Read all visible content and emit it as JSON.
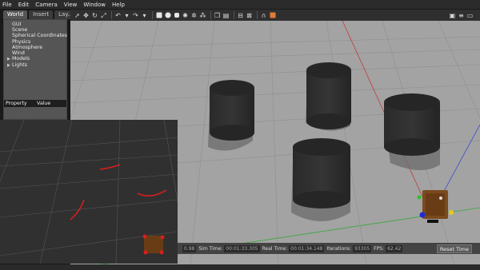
{
  "menu": [
    "File",
    "Edit",
    "Camera",
    "View",
    "Window",
    "Help"
  ],
  "left_tabs": [
    "World",
    "Insert",
    "Lay..."
  ],
  "tree": [
    {
      "label": "GUI",
      "expandable": false
    },
    {
      "label": "Scene",
      "expandable": false
    },
    {
      "label": "Spherical Coordinates",
      "expandable": false
    },
    {
      "label": "Physics",
      "expandable": false
    },
    {
      "label": "Atmosphere",
      "expandable": false
    },
    {
      "label": "Wind",
      "expandable": false
    },
    {
      "label": "Models",
      "expandable": true
    },
    {
      "label": "Lights",
      "expandable": true
    }
  ],
  "properties": {
    "col1": "Property",
    "col2": "Value"
  },
  "status": {
    "rtf_value": "0.98",
    "sim_time_label": "Sim Time:",
    "sim_time_value": "00:01:33.305",
    "real_time_label": "Real Time:",
    "real_time_value": "00:01:34.148",
    "iterations_label": "Iterations:",
    "iterations_value": "93305",
    "fps_label": "FPS:",
    "fps_value": "62.42",
    "reset_label": "Reset Time"
  },
  "colors": {
    "ground": "#a3a3a3",
    "cylinder": "#2e2e2e",
    "shadow": "#6e6e6e",
    "axis_x": "#c23b3b",
    "axis_y": "#3aa83a",
    "axis_z": "#3c4fd1",
    "laser": "#d81e1e"
  }
}
